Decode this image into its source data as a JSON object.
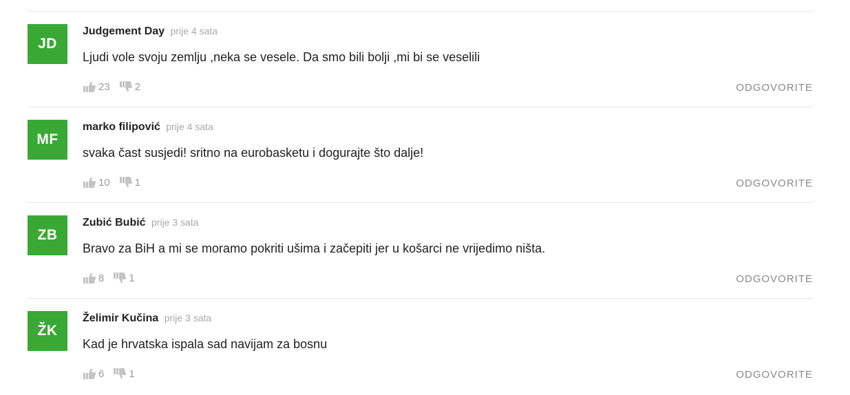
{
  "theme": {
    "avatar_color": "#3aa834",
    "muted_color": "#9a9a9a"
  },
  "comments": [
    {
      "initials": "JD",
      "author": "Judgement Day",
      "time": "prije 4 sata",
      "text": "Ljudi vole svoju zemlju ,neka se vesele. Da smo bili bolji ,mi bi se veselili",
      "likes": "23",
      "dislikes": "2",
      "reply_label": "ODGOVORITE"
    },
    {
      "initials": "MF",
      "author": "marko filipović",
      "time": "prije 4 sata",
      "text": "svaka čast susjedi! sritno na eurobasketu i dogurajte što dalje!",
      "likes": "10",
      "dislikes": "1",
      "reply_label": "ODGOVORITE"
    },
    {
      "initials": "ZB",
      "author": "Zubić Bubić",
      "time": "prije 3 sata",
      "text": "Bravo za BiH a mi se moramo pokriti ušima i začepiti jer u košarci ne vrijedimo ništa.",
      "likes": "8",
      "dislikes": "1",
      "reply_label": "ODGOVORITE"
    },
    {
      "initials": "ŽK",
      "author": "Želimir Kučina",
      "time": "prije 3 sata",
      "text": "Kad je hrvatska ispala sad navijam za bosnu",
      "likes": "6",
      "dislikes": "1",
      "reply_label": "ODGOVORITE"
    }
  ]
}
